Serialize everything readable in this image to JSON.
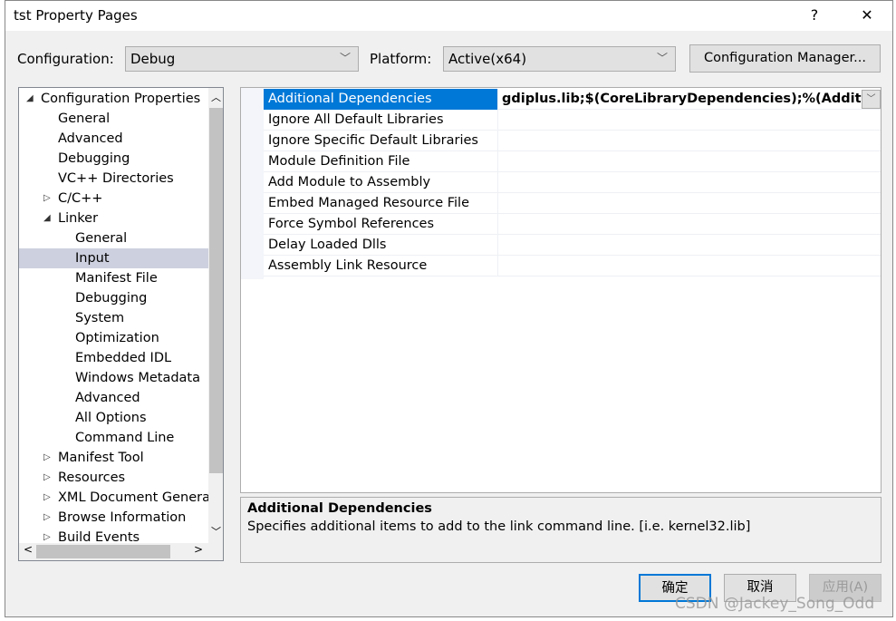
{
  "window": {
    "title": "tst Property Pages",
    "help": "?",
    "close": "✕"
  },
  "config": {
    "config_label": "Configuration:",
    "config_value": "Debug",
    "platform_label": "Platform:",
    "platform_value": "Active(x64)",
    "manager_button": "Configuration Manager..."
  },
  "tree": {
    "items": [
      {
        "label": "Configuration Properties",
        "level": 0,
        "expander": "expanded"
      },
      {
        "label": "General",
        "level": 1
      },
      {
        "label": "Advanced",
        "level": 1
      },
      {
        "label": "Debugging",
        "level": 1
      },
      {
        "label": "VC++ Directories",
        "level": 1
      },
      {
        "label": "C/C++",
        "level": 1,
        "expander": "collapsed"
      },
      {
        "label": "Linker",
        "level": 1,
        "expander": "expanded"
      },
      {
        "label": "General",
        "level": 2
      },
      {
        "label": "Input",
        "level": 2,
        "selected": true
      },
      {
        "label": "Manifest File",
        "level": 2
      },
      {
        "label": "Debugging",
        "level": 2
      },
      {
        "label": "System",
        "level": 2
      },
      {
        "label": "Optimization",
        "level": 2
      },
      {
        "label": "Embedded IDL",
        "level": 2
      },
      {
        "label": "Windows Metadata",
        "level": 2
      },
      {
        "label": "Advanced",
        "level": 2
      },
      {
        "label": "All Options",
        "level": 2
      },
      {
        "label": "Command Line",
        "level": 2
      },
      {
        "label": "Manifest Tool",
        "level": 1,
        "expander": "collapsed"
      },
      {
        "label": "Resources",
        "level": 1,
        "expander": "collapsed"
      },
      {
        "label": "XML Document Genera",
        "level": 1,
        "expander": "collapsed"
      },
      {
        "label": "Browse Information",
        "level": 1,
        "expander": "collapsed"
      },
      {
        "label": "Build Events",
        "level": 1,
        "expander": "collapsed"
      }
    ]
  },
  "properties": [
    {
      "name": "Additional Dependencies",
      "value": "gdiplus.lib;$(CoreLibraryDependencies);%(AdditionalDependencies)",
      "selected": true
    },
    {
      "name": "Ignore All Default Libraries",
      "value": ""
    },
    {
      "name": "Ignore Specific Default Libraries",
      "value": ""
    },
    {
      "name": "Module Definition File",
      "value": ""
    },
    {
      "name": "Add Module to Assembly",
      "value": ""
    },
    {
      "name": "Embed Managed Resource File",
      "value": ""
    },
    {
      "name": "Force Symbol References",
      "value": ""
    },
    {
      "name": "Delay Loaded Dlls",
      "value": ""
    },
    {
      "name": "Assembly Link Resource",
      "value": ""
    }
  ],
  "description": {
    "title": "Additional Dependencies",
    "text": "Specifies additional items to add to the link command line. [i.e. kernel32.lib]"
  },
  "buttons": {
    "ok": "确定",
    "cancel": "取消",
    "apply": "应用(A)"
  },
  "watermark": "CSDN @Jackey_Song_Odd",
  "colors": {
    "accent": "#0078d7",
    "tree_selection": "#cdd0de"
  }
}
